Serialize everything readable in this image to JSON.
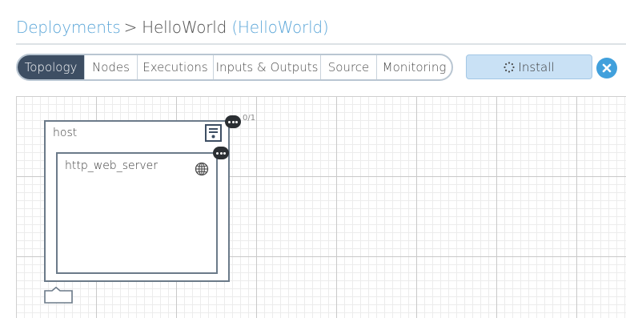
{
  "breadcrumb": {
    "root": "Deployments",
    "separator": ">",
    "name": "HelloWorld",
    "blueprint": "(HelloWorld)"
  },
  "tabs": [
    {
      "label": "Topology",
      "active": true
    },
    {
      "label": "Nodes",
      "active": false
    },
    {
      "label": "Executions",
      "active": false
    },
    {
      "label": "Inputs & Outputs",
      "active": false
    },
    {
      "label": "Source",
      "active": false
    },
    {
      "label": "Monitoring",
      "active": false
    }
  ],
  "actions": {
    "install_label": "Install",
    "close_icon": "close-icon"
  },
  "topology": {
    "host": {
      "label": "host",
      "icon": "server-icon",
      "instances": "0/1"
    },
    "http_web_server": {
      "label": "http_web_server",
      "icon": "globe-icon"
    }
  },
  "colors": {
    "accent": "#41a0dc",
    "link": "#5ba6d8",
    "active_tab": "#3d4e63",
    "install_bg": "#c9e1f5",
    "node_border": "#6b7a89"
  }
}
